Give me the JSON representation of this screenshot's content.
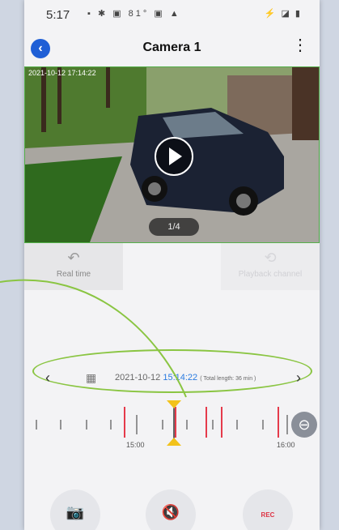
{
  "status": {
    "time": "5:17",
    "left_icons": "▪ ✱ ▣ 81° ▣ ▲",
    "right_icons": "⚡ ◪ ▮"
  },
  "header": {
    "title": "Camera 1"
  },
  "video": {
    "timestamp": "2021-10-12 17:14:22",
    "page": "1/4"
  },
  "modes": {
    "real_time": "Real time",
    "playback_channel": "Playback channel"
  },
  "timeline": {
    "date": "2021-10-12",
    "time": "15:14:22",
    "total": "( Total length: 36 min )",
    "ticks": [
      "15:00",
      "16:00"
    ]
  },
  "bottom": {
    "rec": "REC"
  },
  "colors": {
    "accent": "#1f5fd6",
    "highlight_green": "#8ac542",
    "marker": "#f2c21b",
    "recording_red": "#e53a4b"
  }
}
